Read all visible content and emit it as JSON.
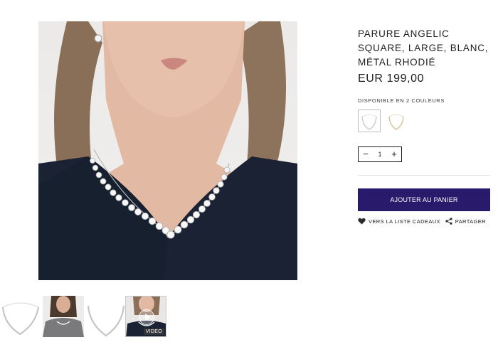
{
  "product": {
    "title": "PARURE ANGELIC SQUARE, LARGE, BLANC, MÉTAL RHODIÉ",
    "price": "EUR 199,00",
    "colors_label": "DISPONIBLE EN 2 COULEURS",
    "swatches": [
      {
        "name": "silver",
        "color": "#cfcfcf",
        "selected": true
      },
      {
        "name": "gold",
        "color": "#d6c7a0",
        "selected": false
      }
    ]
  },
  "quantity": {
    "minus": "−",
    "value": "1",
    "plus": "+"
  },
  "cart": {
    "label": "AJOUTER AU PANIER",
    "color": "#2a1a6b"
  },
  "actions": {
    "wishlist": "VERS LA LISTE CADEAUX",
    "share": "PARTAGER"
  },
  "gallery": {
    "thumbnails": [
      {
        "name": "necklace-product"
      },
      {
        "name": "model-wearing"
      },
      {
        "name": "necklace-product-alt"
      },
      {
        "name": "video",
        "label": "VIDEO"
      }
    ]
  }
}
